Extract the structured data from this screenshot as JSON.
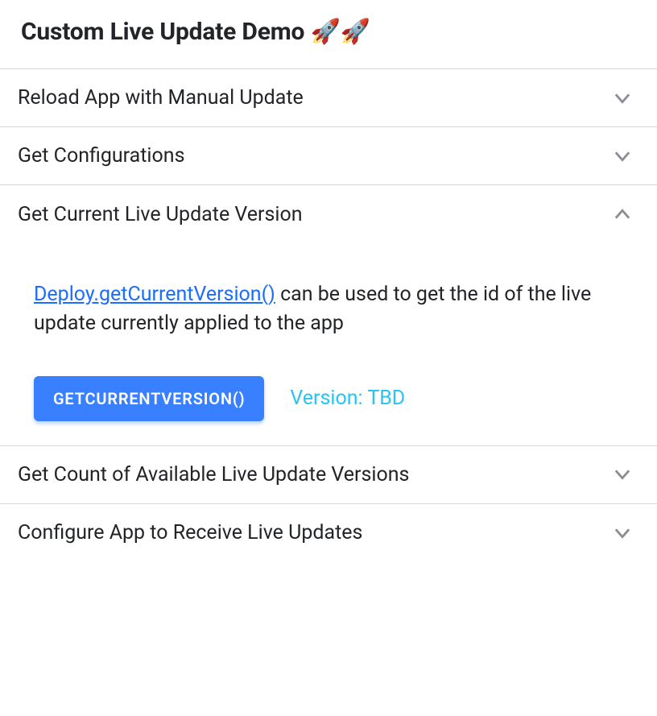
{
  "header": {
    "title": "Custom Live Update Demo 🚀🚀"
  },
  "items": [
    {
      "title": "Reload App with Manual Update",
      "expanded": false
    },
    {
      "title": "Get Configurations",
      "expanded": false
    },
    {
      "title": "Get Current Live Update Version",
      "expanded": true,
      "content": {
        "link_text": "Deploy.getCurrentVersion()",
        "desc_rest": " can be used to get the id of the live update currently applied to the app",
        "button_label": "getCurrentVersion()",
        "version_text": "Version: TBD"
      }
    },
    {
      "title": "Get Count of Available Live Update Versions",
      "expanded": false
    },
    {
      "title": "Configure App to Receive Live Updates",
      "expanded": false
    }
  ]
}
